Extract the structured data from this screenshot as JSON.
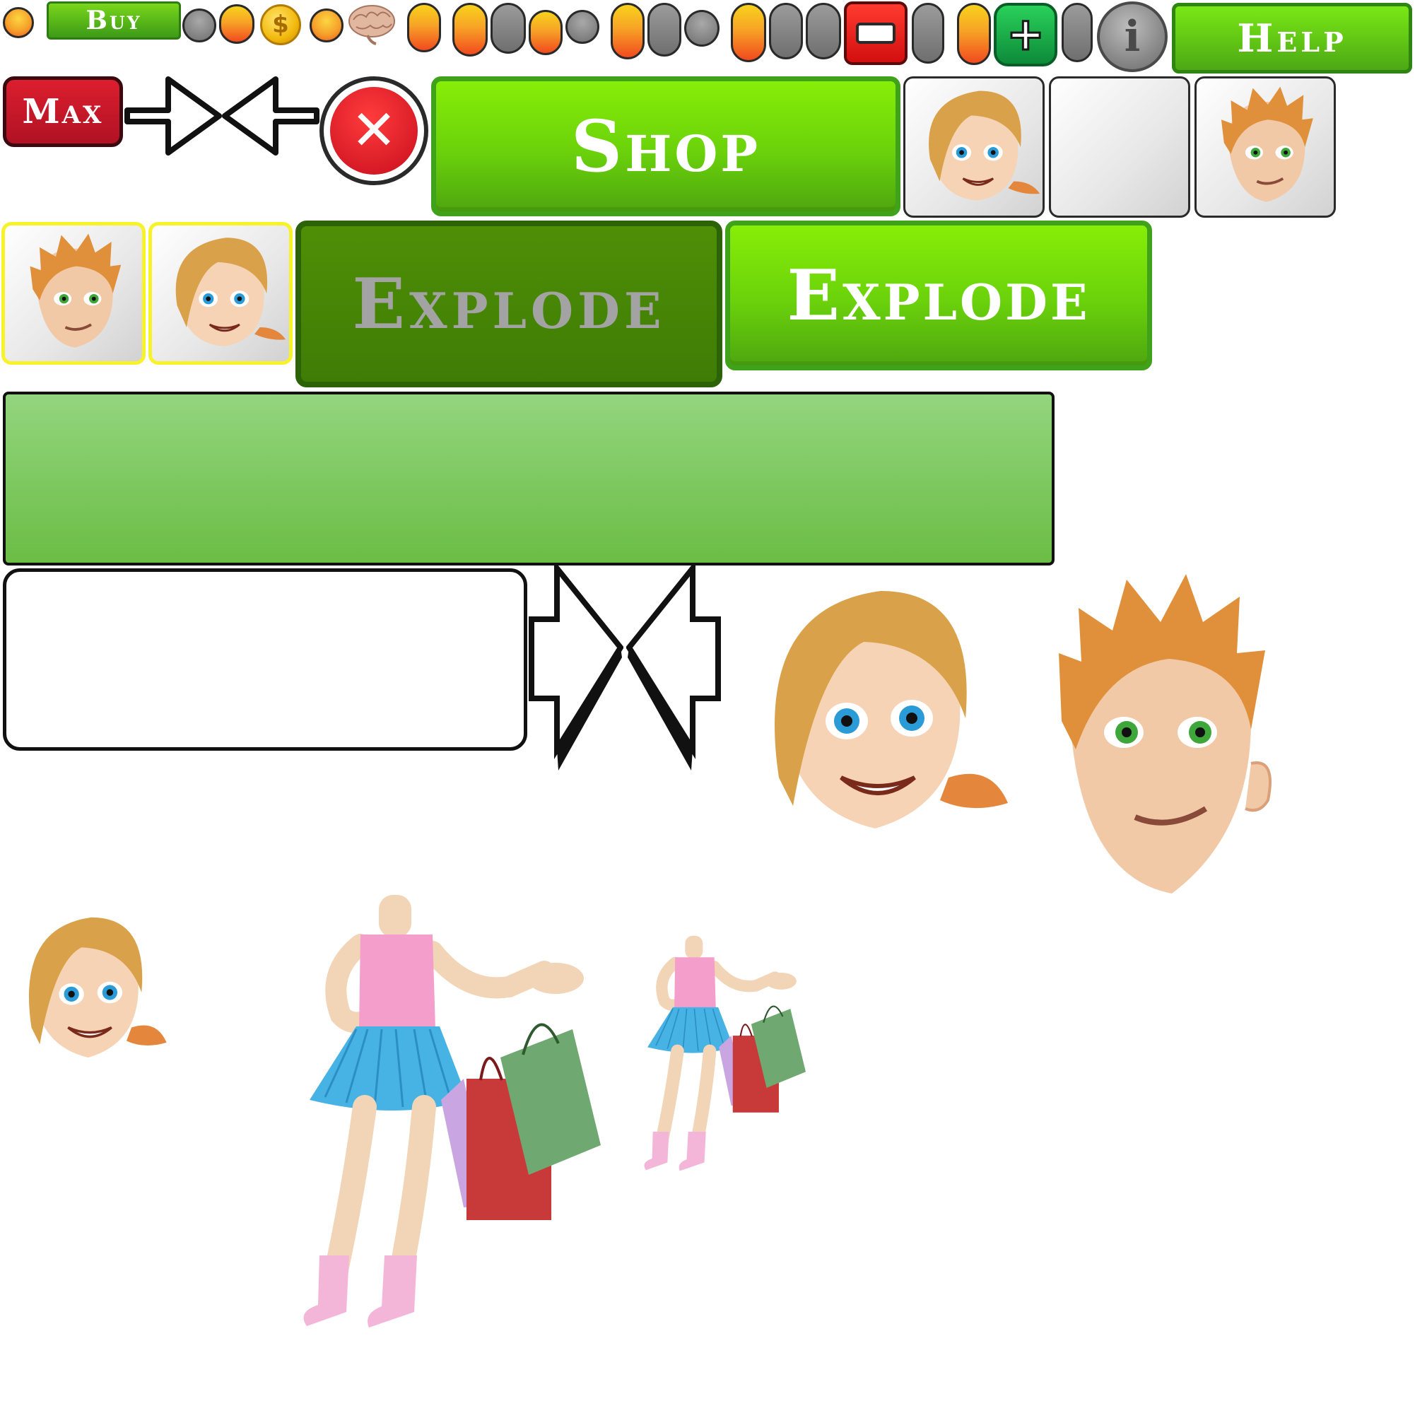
{
  "buttons": {
    "buy": "Buy",
    "help": "Help",
    "max": "Max",
    "shop": "Shop",
    "explode_disabled": "Explode",
    "explode": "Explode"
  },
  "icons": {
    "minus": "−",
    "plus": "+",
    "info": "i",
    "close": "✕",
    "coin": "$"
  },
  "colors": {
    "accent_green": "#6ad10b",
    "dark_green": "#3f7c06",
    "close_red": "#d8192a",
    "max_red": "#c4172a",
    "selected_border": "#f7f229"
  }
}
